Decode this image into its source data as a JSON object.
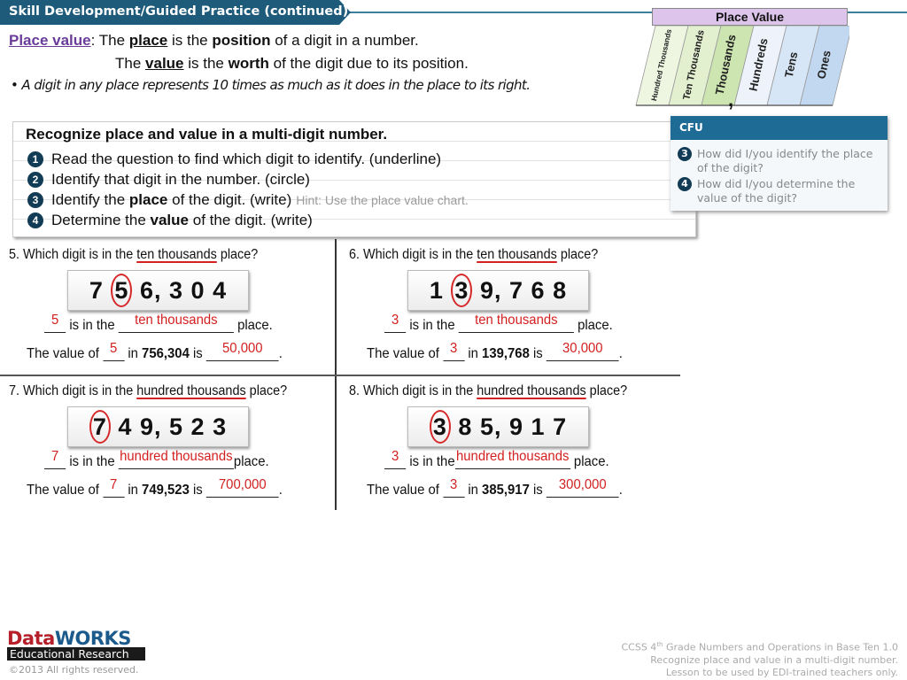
{
  "header": {
    "title": "Skill Development/Guided Practice (continued)"
  },
  "definitions": {
    "line1": {
      "term": "Place value",
      "pre": ": The ",
      "place": "place",
      "mid": " is the ",
      "position": "position",
      "post": " of a digit in a number."
    },
    "line2": {
      "pre": "The ",
      "value": "value",
      "mid": " is the ",
      "worth": "worth",
      "post": " of the digit due to its position."
    },
    "bullet": "•  A digit in any place represents 10 times as much as it does in the place to its right."
  },
  "place_value_chart": {
    "title": "Place Value",
    "columns": [
      "Hundred Thousands",
      "Ten Thousands",
      "Thousands",
      "Hundreds",
      "Tens",
      "Ones"
    ],
    "colors": [
      "#eef6e2",
      "#e3f0d0",
      "#cde5b1",
      "#eef3fb",
      "#d7e6f6",
      "#c2d8f0"
    ]
  },
  "steps": {
    "title": "Recognize place and value in a multi-digit number.",
    "items": [
      {
        "n": "1",
        "text": "Read the question to find which digit to identify. (underline)"
      },
      {
        "n": "2",
        "text": "Identify that digit in the number. (circle)"
      },
      {
        "n": "3",
        "pre": "Identify the ",
        "bold": "place",
        "post": " of the digit. (write)",
        "hint": "Hint: Use the place value chart."
      },
      {
        "n": "4",
        "pre": "Determine the ",
        "bold": "value",
        "post": " of the digit. (write)"
      }
    ]
  },
  "cfu": {
    "title": "CFU",
    "questions": [
      {
        "n": "3",
        "text": "How did I/you identify the place of the digit?"
      },
      {
        "n": "4",
        "text": "How did I/you determine the value of the digit?"
      }
    ]
  },
  "problems": [
    {
      "num": "5.",
      "q_pre": "Which digit is in the ",
      "q_place": "ten thousands",
      "q_post": " place?",
      "digits": [
        "7",
        "5",
        "6",
        ",",
        "3",
        "0",
        "4"
      ],
      "circled_index": 1,
      "is_in_the": " is in the ",
      "place_word": " place.",
      "value_of": "The value of ",
      "in": " in ",
      "is": " is ",
      "period": ".",
      "answer_digit": "5",
      "answer_place": "ten thousands",
      "number": "756,304",
      "answer_value": "50,000"
    },
    {
      "num": "6.",
      "q_pre": "Which digit is in the ",
      "q_place": "ten thousands",
      "q_post": " place?",
      "digits": [
        "1",
        "3",
        "9",
        ",",
        "7",
        "6",
        "8"
      ],
      "circled_index": 1,
      "is_in_the": " is in the ",
      "place_word": " place.",
      "value_of": "The value of ",
      "in": " in ",
      "is": " is ",
      "period": ".",
      "answer_digit": "3",
      "answer_place": "ten thousands",
      "number": "139,768",
      "answer_value": "30,000"
    },
    {
      "num": "7.",
      "q_pre": "Which digit is in the ",
      "q_place": "hundred thousands",
      "q_post": " place?",
      "digits": [
        "7",
        "4",
        "9",
        ",",
        "5",
        "2",
        "3"
      ],
      "circled_index": 0,
      "is_in_the": " is in the ",
      "place_word": "place.",
      "value_of": "The value of ",
      "in": " in ",
      "is": " is ",
      "period": ".",
      "answer_digit": "7",
      "answer_place": "hundred thousands",
      "number": "749,523",
      "answer_value": "700,000"
    },
    {
      "num": "8.",
      "q_pre": "Which digit is in the ",
      "q_place": "hundred thousands",
      "q_post": " place?",
      "digits": [
        "3",
        "8",
        "5",
        ",",
        "9",
        "1",
        "7"
      ],
      "circled_index": 0,
      "is_in_the": " is in the",
      "place_word": " place.",
      "value_of": "The value of ",
      "in": " in ",
      "is": " is ",
      "period": ".",
      "answer_digit": "3",
      "answer_place": "hundred thousands",
      "number": "385,917",
      "answer_value": "300,000"
    }
  ],
  "footer": {
    "logo_top_a": "Data",
    "logo_top_b": "WORKS",
    "logo_bottom": "Educational Research",
    "copyright": "©2013 All rights reserved.",
    "ccss_line1_a": "CCSS 4",
    "ccss_line1_sup": "th",
    "ccss_line1_b": " Grade Numbers and Operations in Base Ten 1.0",
    "ccss_line2": "Recognize place and value in a multi-digit number.",
    "ccss_line3": "Lesson to be used by EDI-trained teachers only."
  }
}
